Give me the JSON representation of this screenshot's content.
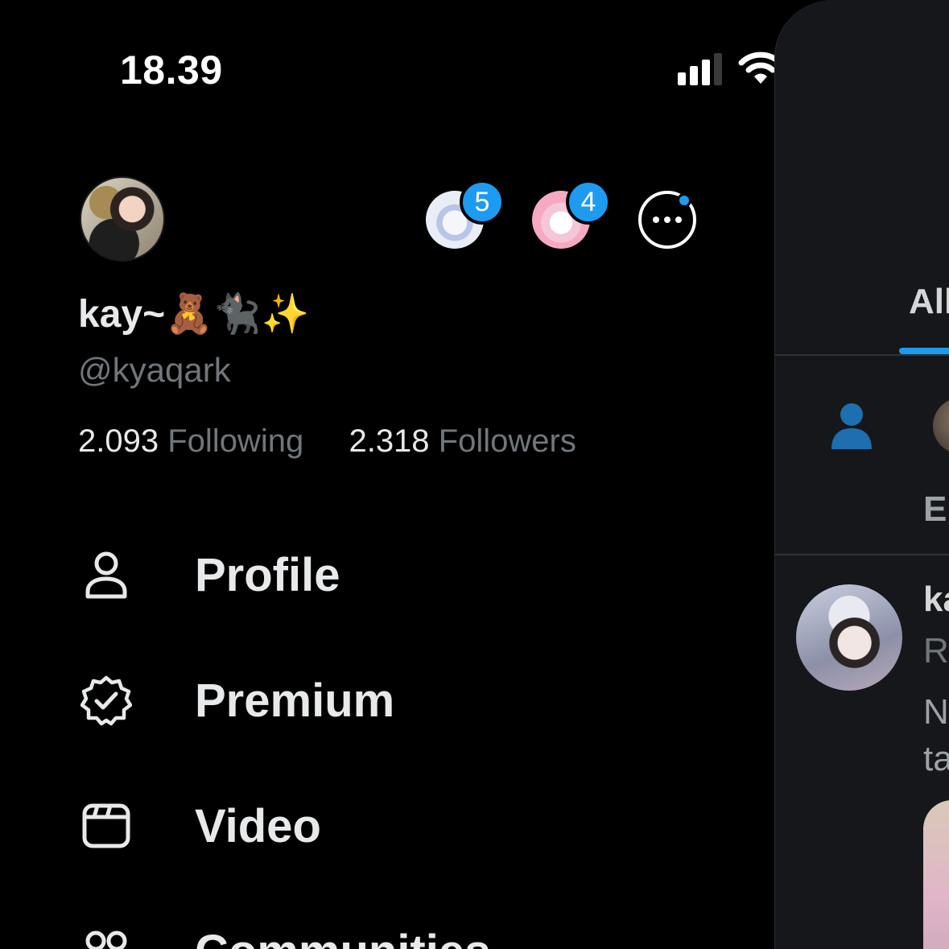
{
  "status_bar": {
    "time": "18.39",
    "signal_bars": 4,
    "signal_active": 3,
    "wifi": "wifi-icon",
    "battery": "battery-icon"
  },
  "account": {
    "display_name": "kay~🧸🐈‍⬛✨",
    "handle": "@kyaqark",
    "following_count": "2.093",
    "following_label": "Following",
    "followers_count": "2.318",
    "followers_label": "Followers"
  },
  "other_accounts": [
    {
      "badge": "5"
    },
    {
      "badge": "4"
    }
  ],
  "menu": [
    {
      "label": "Profile",
      "icon": "person-icon"
    },
    {
      "label": "Premium",
      "icon": "verified-badge-icon"
    },
    {
      "label": "Video",
      "icon": "video-icon"
    },
    {
      "label": "Communities",
      "icon": "communities-icon"
    }
  ],
  "background_panel": {
    "tab_label": "All",
    "row_label": "El",
    "post_author": "ka",
    "post_subline": "Re",
    "post_text_line1": "N",
    "post_text_line2": "ta"
  },
  "colors": {
    "accent": "#1d9bf0",
    "text_primary": "#e7e9ea",
    "text_secondary": "#71767b",
    "background": "#000000",
    "panel": "#16171a"
  }
}
